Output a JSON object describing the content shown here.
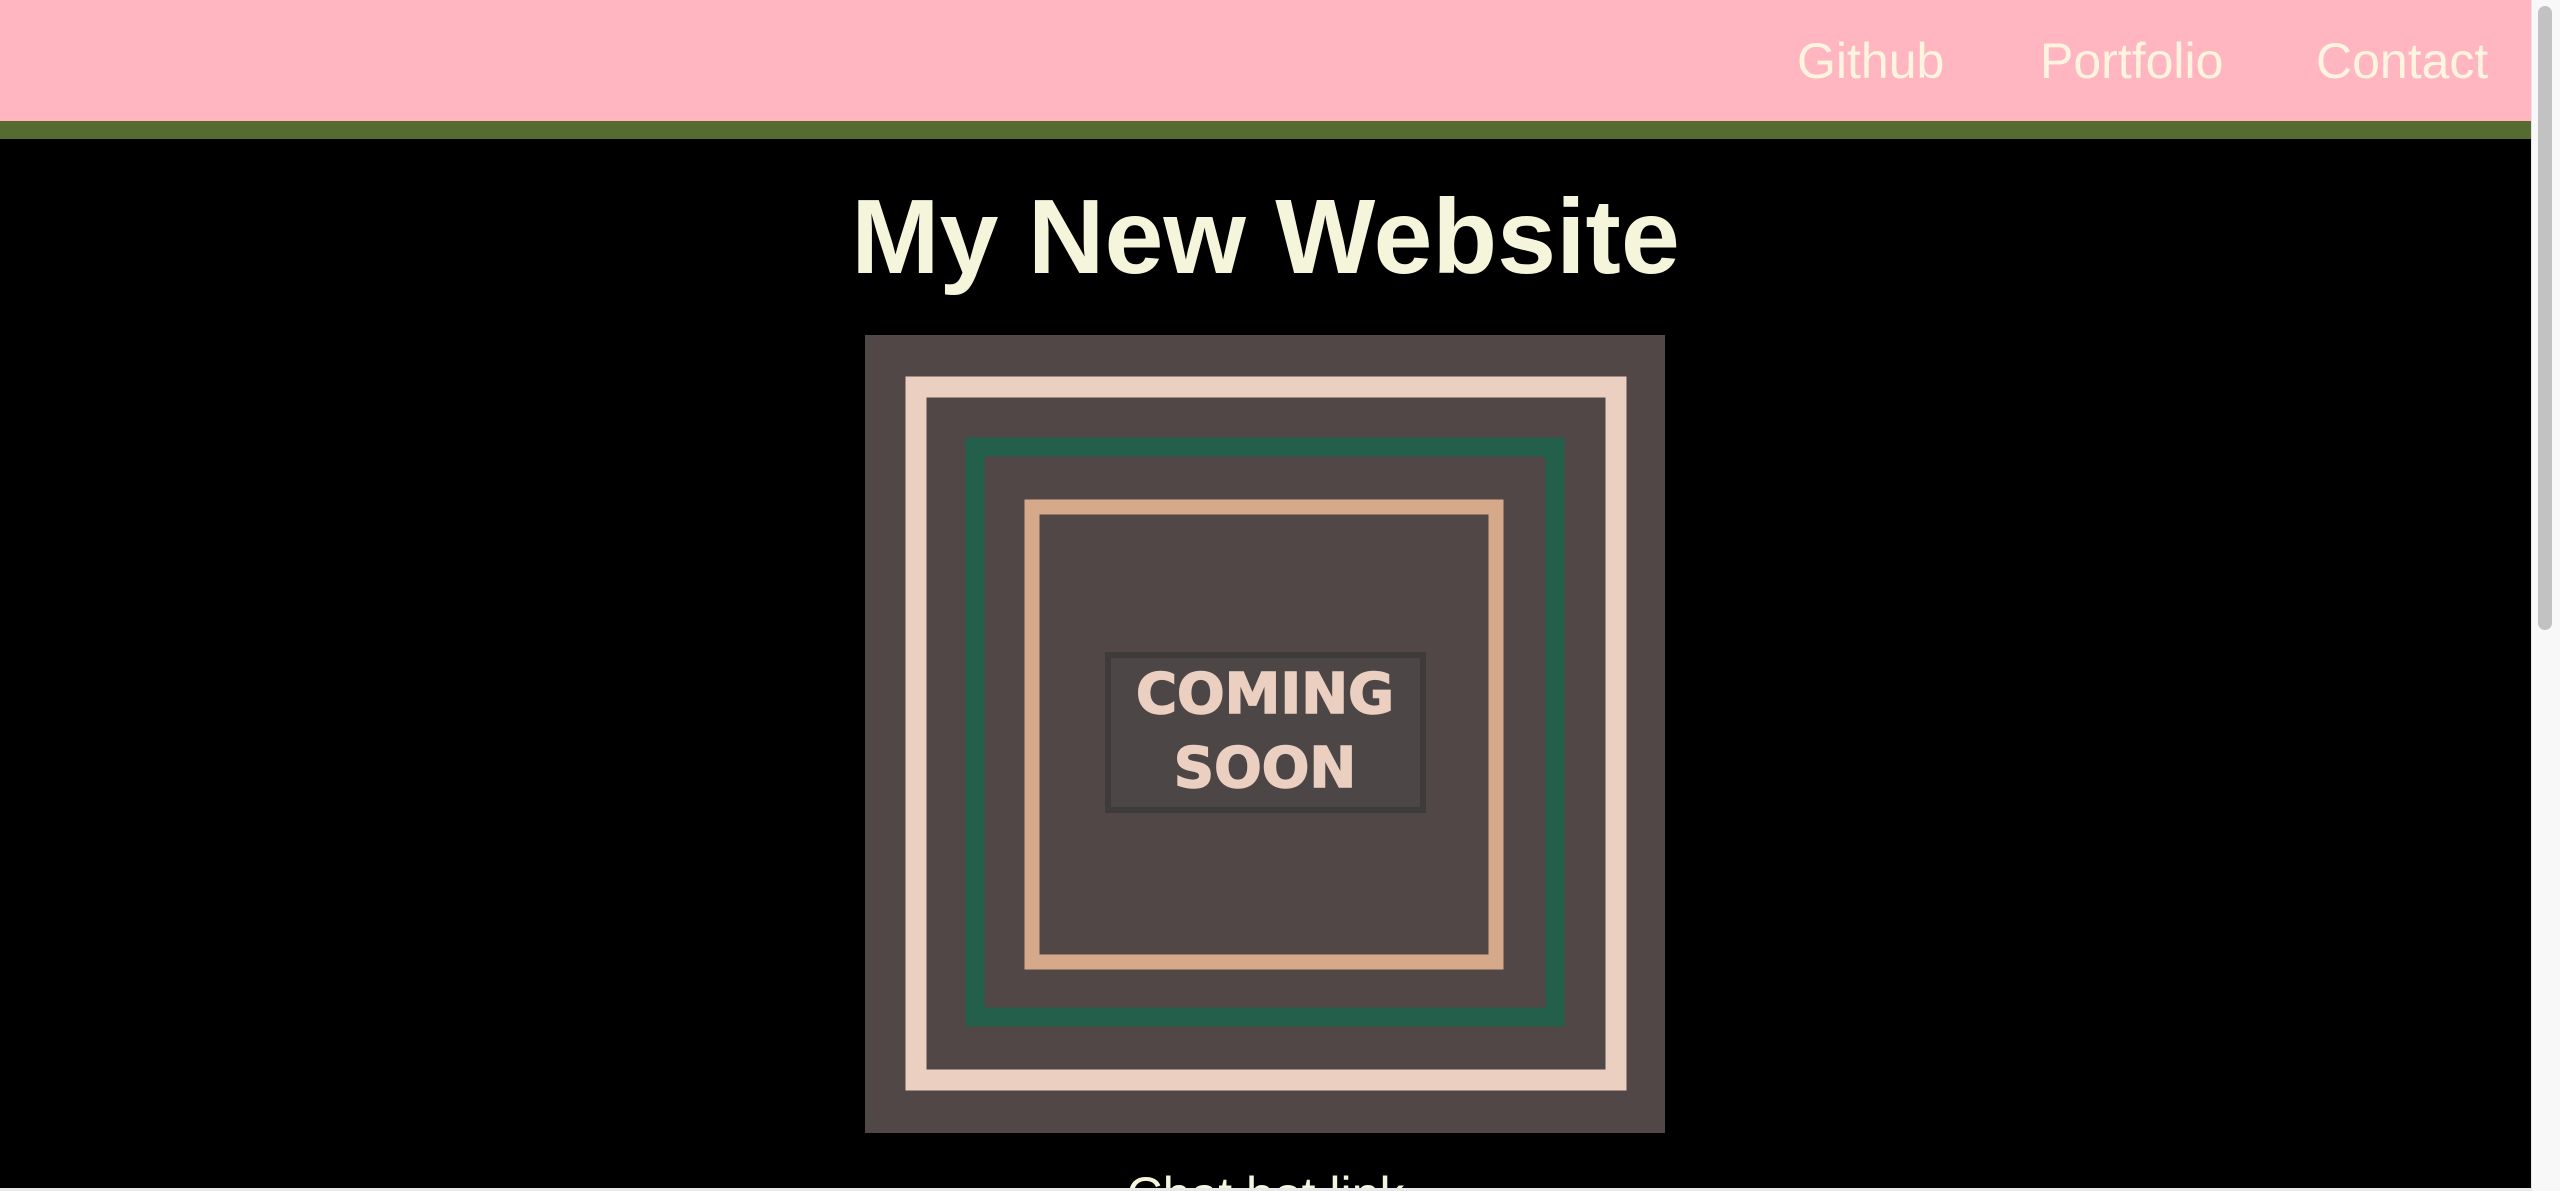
{
  "nav": {
    "links": [
      {
        "label": "Github"
      },
      {
        "label": "Portfolio"
      },
      {
        "label": "Contact"
      }
    ]
  },
  "main": {
    "title": "My New Website",
    "hero_image": {
      "text_line1": "COMING",
      "text_line2": "SOON"
    },
    "subtitle": "Chat bot link"
  },
  "colors": {
    "header_bg": "#ffb6c1",
    "header_border": "#556b2f",
    "page_bg": "#000000",
    "nav_text": "#fff4e0",
    "title_text": "#f5f5dc",
    "image_bg": "#514747",
    "frame_outer": "#ebcfc0",
    "frame_middle": "#235f4a",
    "frame_inner": "#d6a98a"
  }
}
